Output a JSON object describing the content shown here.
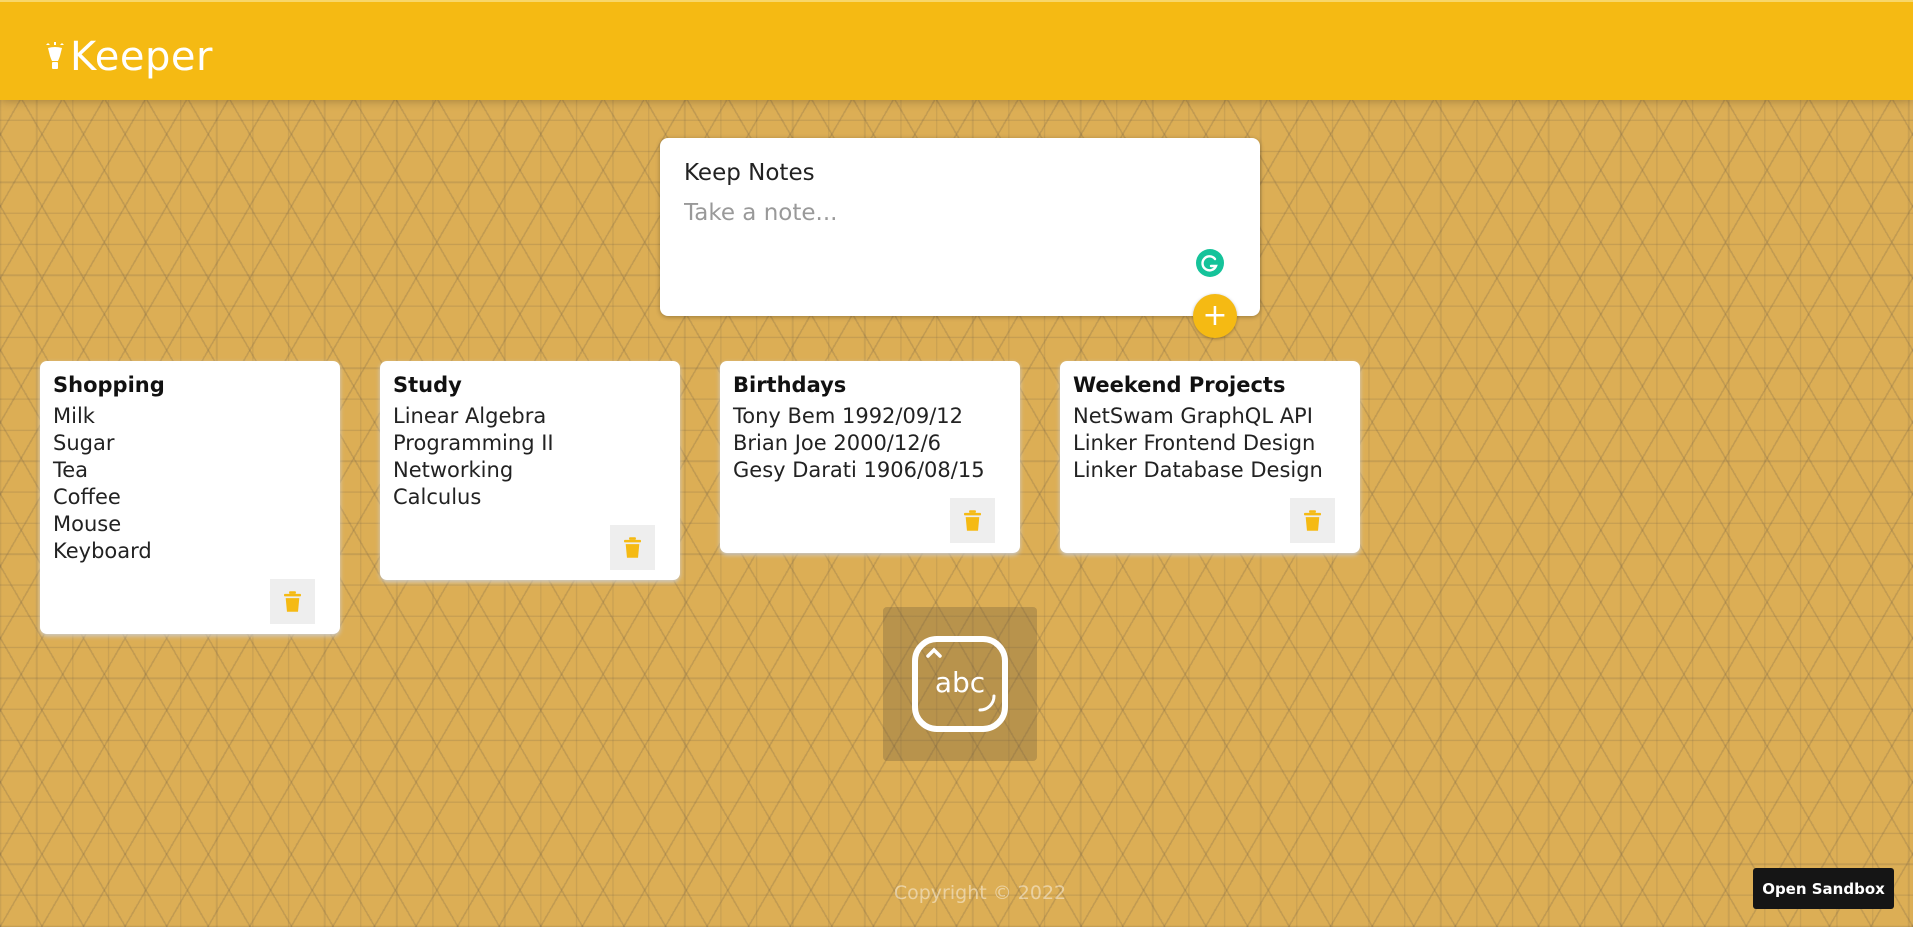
{
  "header": {
    "brand": "Keeper"
  },
  "create_note": {
    "title": "Keep Notes",
    "placeholder": "Take a note...",
    "add_label": "+"
  },
  "notes": [
    {
      "title": "Shopping",
      "items": [
        "Milk",
        "Sugar",
        "Tea",
        "Coffee",
        "Mouse",
        "Keyboard"
      ]
    },
    {
      "title": "Study",
      "items": [
        "Linear Algebra",
        "Programming II",
        "Networking",
        "Calculus"
      ]
    },
    {
      "title": "Birthdays",
      "items": [
        "Tony Bem 1992/09/12",
        "Brian Joe 2000/12/6",
        "Gesy Darati 1906/08/15"
      ]
    },
    {
      "title": "Weekend Projects",
      "items": [
        "NetSwam GraphQL API",
        "Linker Frontend Design",
        "Linker Database Design"
      ]
    }
  ],
  "ime_indicator": {
    "text": "abc"
  },
  "footer": {
    "copyright": "Copyright © 2022"
  },
  "sandbox": {
    "label": "Open Sandbox"
  },
  "colors": {
    "accent": "#f5ba13",
    "grammarly": "#15c39a",
    "background": "#dcae55"
  },
  "icons": [
    "lightbulb-icon",
    "grammarly-icon",
    "plus-icon",
    "trash-icon",
    "input-method-icon"
  ]
}
